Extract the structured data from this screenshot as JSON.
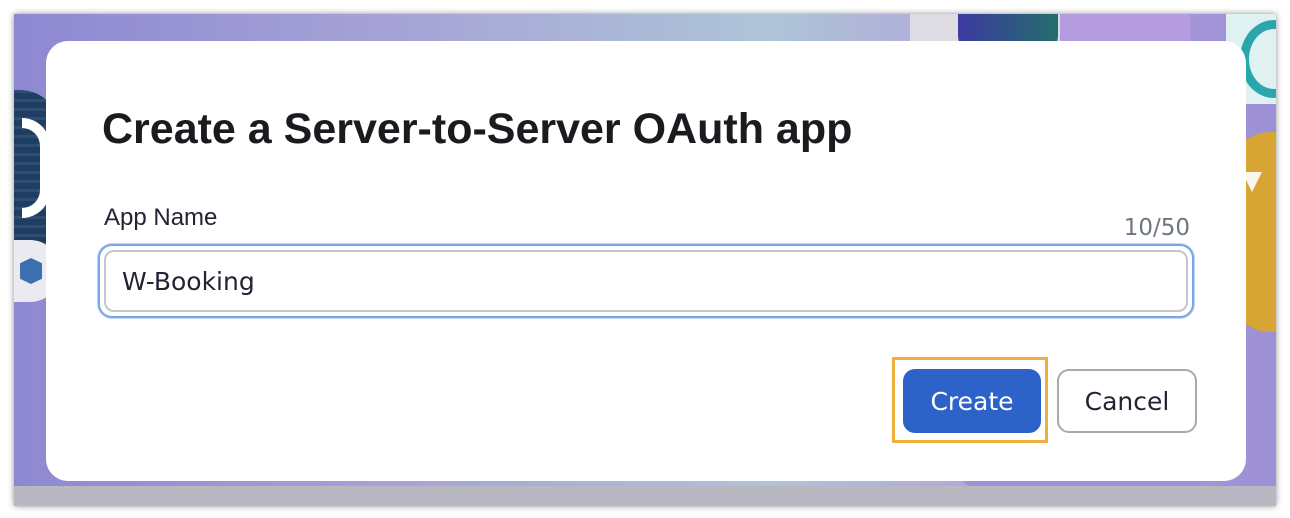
{
  "dialog": {
    "title": "Create a Server-to-Server OAuth app",
    "app_name_field": {
      "label": "App Name",
      "value": "W-Booking",
      "char_count": "10/50"
    },
    "buttons": {
      "create_label": "Create",
      "cancel_label": "Cancel"
    }
  },
  "colors": {
    "primary_button": "#2d62c9",
    "highlight_outline": "#efb03b",
    "input_focus_ring": "#7aa6e6",
    "title_text": "#1b1b1f"
  }
}
